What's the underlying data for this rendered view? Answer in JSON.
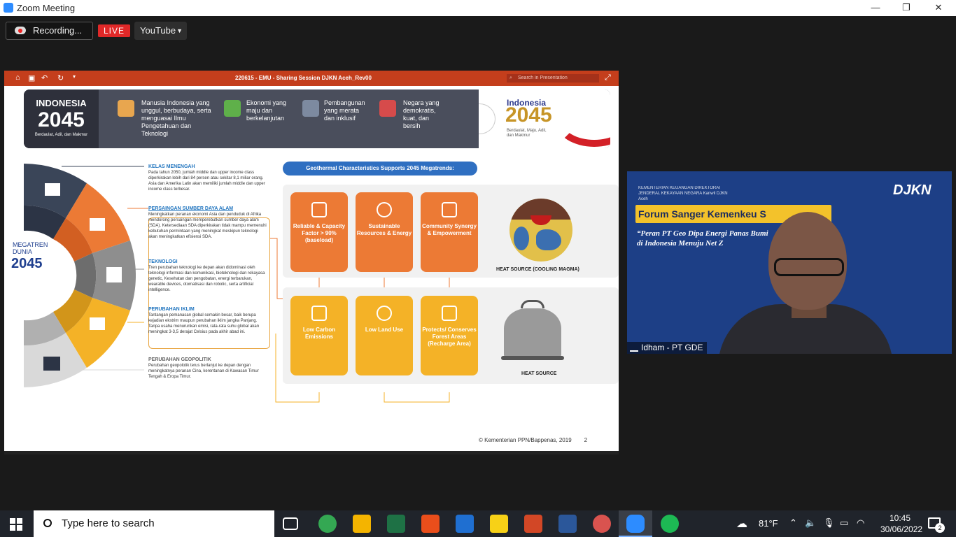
{
  "window": {
    "title": "Zoom Meeting",
    "minimize": "—",
    "maximize": "❐",
    "close": "✕"
  },
  "toolbar": {
    "recording_label": "Recording...",
    "live_label": "LIVE",
    "stream_target": "YouTube"
  },
  "presentation": {
    "title": "220615 - EMU - Sharing Session DJKN Aceh_Rev00",
    "search_placeholder": "Search in Presentation",
    "header": {
      "country": "INDONESIA",
      "year": "2045",
      "tagline": "Berdaulat, Adil, dan Makmur",
      "visions": [
        "Manusia Indonesia yang unggul, berbudaya, serta menguasai Ilmu Pengetahuan dan Teknologi",
        "Ekonomi yang maju dan berkelanjutan",
        "Pembangunan yang merata dan inklusif",
        "Negara yang demokratis, kuat, dan bersih"
      ],
      "logo_title": "Indonesia",
      "logo_year": "2045",
      "logo_tagline": "Berdaulat, Maju, Adil, dan Makmur"
    },
    "megatren": {
      "label": "MEGATREN DUNIA",
      "year": "2045"
    },
    "trends": [
      {
        "title": "KELAS MENENGAH",
        "text": "Pada tahun 2050, jumlah middle dan upper income class diperkirakan lebih dari 84 persen atau sekitar 8,1 miliar orang. Asia dan Amerika Latin akan memiliki jumlah middle dan upper income class terbesar."
      },
      {
        "title": "PERSAINGAN SUMBER DAYA ALAM",
        "text": "Meningkatkan peranan ekonomi Asia dan penduduk di Afrika mendorong persaingan memperebutkan sumber daya alam (SDA). Ketersediaan SDA diperkirakan tidak mampu memenuhi kebutuhan permintaan yang meningkat meskipun teknologi akan meningkatkan efisiensi SDA."
      },
      {
        "title": "TEKNOLOGI",
        "text": "Tren perubahan teknologi ke depan akan didominasi oleh teknologi informasi dan komunikasi, bioteknologi dan rekayasa genetic, Kesehatan dan pengobatan, energi terbarukan, wearable devices, otomatisasi dan robotic, serta artificial intelligence."
      },
      {
        "title": "PERUBAHAN IKLIM",
        "text": "Tantangan pemanasan global semakin besar, baik berupa kejadian ekstrim maupun perubahan iklim jangka Panjang. Tanpa usaha menurunkan emisi, rata-rata suhu global akan meningkat 3-3,5 derajat Celsius pada akhir abad ini."
      },
      {
        "title": "PERUBAHAN GEOPOLITIK",
        "text": "Perubahan geopolotik terus berlanjut ke depan dengan meningkatnya peranan Cina, kerentanan di Kawasan Timur Tengah & Eropa Timur."
      }
    ],
    "geothermal_title": "Geothermal Characteristics Supports 2045 Megatrends:",
    "cards_top": [
      "Reliable & Capacity Factor > 90% (baseload)",
      "Sustainable Resources & Energy",
      "Community Synergy & Empowerment"
    ],
    "cards_bottom": [
      "Low Carbon Emissions",
      "Low Land Use",
      "Protects/ Conserves Forest Areas (Recharge Area)"
    ],
    "heat_label_1": "HEAT SOURCE (COOLING MAGMA)",
    "heat_label_2": "HEAT SOURCE",
    "copyright": "© Kementerian PPN/Bappenas, 2019",
    "page_number": "2"
  },
  "video": {
    "org": "KEMENTERIAN KEUANGAN DIREKTORAT JENDERAL KEKAYAAN NEGARA Kanwil DJKN Aceh",
    "brand": "DJKN",
    "forum": "Forum Sanger Kemenkeu S",
    "quote_line1": "“Peran PT Geo Dipa Energi              Panas Bumi",
    "quote_line2": "di Indonesia Menuju Net Z",
    "participant": "Idham - PT GDE"
  },
  "taskbar": {
    "search_placeholder": "Type here to search",
    "weather": "81°F",
    "time": "10:45",
    "date": "30/06/2022",
    "notifications": "2"
  },
  "colors": {
    "orange": "#ec7a35",
    "yellow": "#f4b227",
    "ppt_red": "#c43e1c",
    "live_red": "#e02828",
    "zoom_blue": "#2d8cff"
  }
}
